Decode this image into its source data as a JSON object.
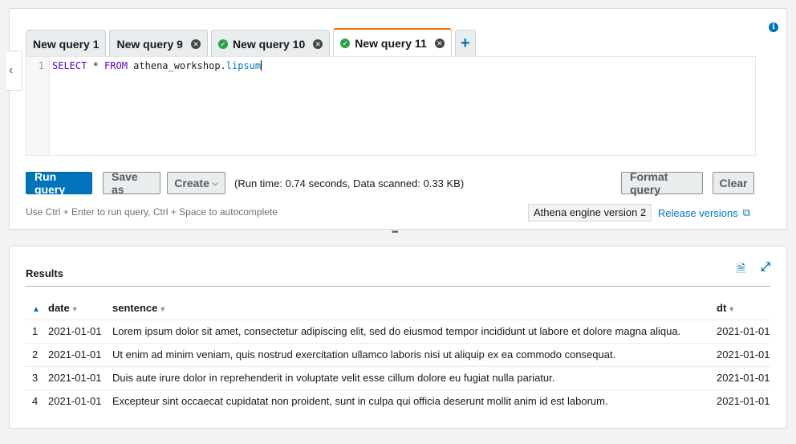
{
  "tabs": [
    {
      "label": "New query 1",
      "status": "none",
      "closable": false,
      "active": false
    },
    {
      "label": "New query 9",
      "status": "none",
      "closable": true,
      "active": false
    },
    {
      "label": "New query 10",
      "status": "success",
      "closable": true,
      "active": false
    },
    {
      "label": "New query 11",
      "status": "success",
      "closable": true,
      "active": true
    }
  ],
  "tab_add_label": "+",
  "editor": {
    "line_number": "1",
    "query": {
      "kw1": "SELECT",
      "star": " * ",
      "kw2": "FROM",
      "db": " athena_workshop",
      "sep": ".",
      "table": "lipsum"
    }
  },
  "buttons": {
    "run": "Run query",
    "save_as": "Save as",
    "create": "Create",
    "format": "Format query",
    "clear": "Clear"
  },
  "run_info": "(Run time: 0.74 seconds, Data scanned: 0.33 KB)",
  "hint": "Use Ctrl + Enter to run query, Ctrl + Space to autocomplete",
  "engine_version": "Athena engine version 2",
  "release_link": "Release versions",
  "results": {
    "title": "Results",
    "columns": [
      "date",
      "sentence",
      "dt"
    ],
    "rows": [
      {
        "n": "1",
        "date": "2021-01-01",
        "sentence": "Lorem ipsum dolor sit amet, consectetur adipiscing elit, sed do eiusmod tempor incididunt ut labore et dolore magna aliqua.",
        "dt": "2021-01-01"
      },
      {
        "n": "2",
        "date": "2021-01-01",
        "sentence": "Ut enim ad minim veniam, quis nostrud exercitation ullamco laboris nisi ut aliquip ex ea commodo consequat.",
        "dt": "2021-01-01"
      },
      {
        "n": "3",
        "date": "2021-01-01",
        "sentence": "Duis aute irure dolor in reprehenderit in voluptate velit esse cillum dolore eu fugiat nulla pariatur.",
        "dt": "2021-01-01"
      },
      {
        "n": "4",
        "date": "2021-01-01",
        "sentence": "Excepteur sint occaecat cupidatat non proident, sunt in culpa qui officia deserunt mollit anim id est laborum.",
        "dt": "2021-01-01"
      }
    ]
  },
  "icons": {
    "collapse": "chevron-left-icon",
    "info": "info-icon",
    "success": "check-circle-icon",
    "close": "close-circle-icon",
    "external": "external-link-icon",
    "download": "download-icon",
    "expand": "expand-icon",
    "sort_asc": "sort-ascending-icon",
    "sort": "sort-icon"
  },
  "colors": {
    "primary": "#0073bb",
    "active_tab": "#ec7211",
    "success": "#2ea04a"
  }
}
